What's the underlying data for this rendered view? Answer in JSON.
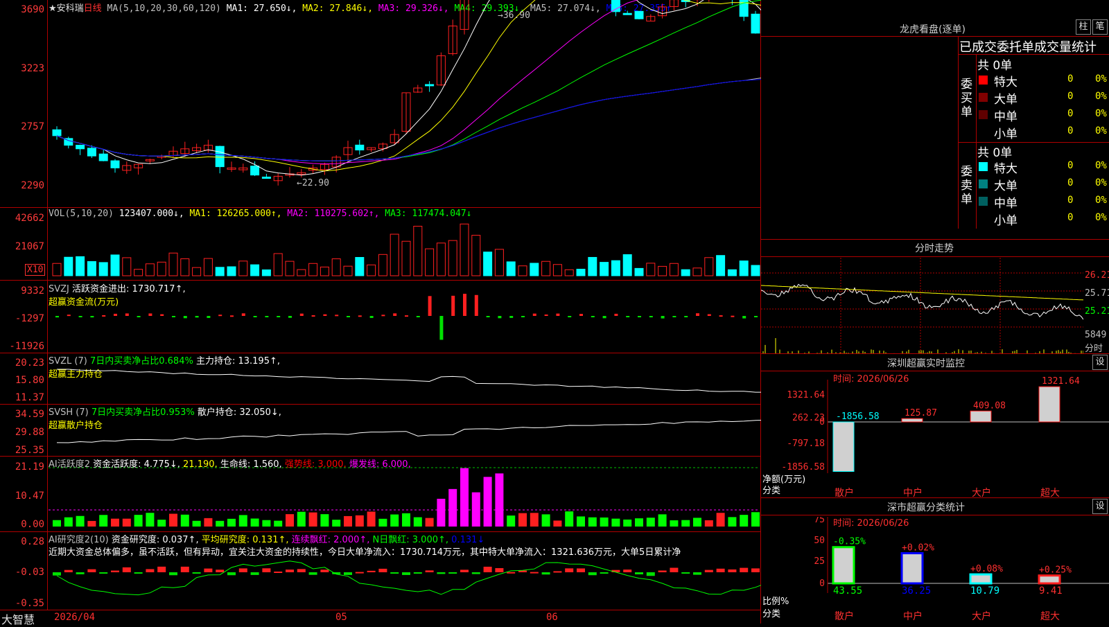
{
  "colors": {
    "up": "#ff2020",
    "down": "#00ffff",
    "ma1": "#ffffff",
    "ma2": "#ffff00",
    "ma3": "#ff00ff",
    "ma4": "#00ff00",
    "ma5": "#c0c0c0",
    "ma6": "#0000ff",
    "grid": "#b00000"
  },
  "header": {
    "stock": "★安科瑞",
    "period": "日线",
    "ma_def": "MA(5,10,20,30,60,120)",
    "ma1": "MA1: 27.650↓,",
    "ma2": "MA2: 27.846↓,",
    "ma3": "MA3: 29.326↓,",
    "ma4": "MA4: 29.393↓,",
    "ma5": "MA5: 27.074↓,",
    "ma6": "MA6: 27.355↑"
  },
  "price_axis": [
    "3690",
    "3223",
    "2757",
    "2290"
  ],
  "price_marks": {
    "high": "36.90",
    "low": "22.90"
  },
  "vol": {
    "title": "VOL(5,10,20)",
    "value": "123407.000↓,",
    "ma1": "MA1: 126265.000↑,",
    "ma2": "MA2: 110275.602↑,",
    "ma3": "MA3: 117474.047↓",
    "axis": [
      "42662",
      "21067"
    ],
    "unit": "X10"
  },
  "svzj": {
    "title": "SVZJ",
    "line1": "活跃资金进出: 1730.717↑,",
    "line2": "超赢资金流(万元)",
    "axis": [
      "9332",
      "-1297",
      "-11926"
    ]
  },
  "svzl": {
    "title": "SVZL (7)",
    "desc": "7日内买卖净占比0.684%",
    "hold": "主力持仓: 13.195↑,",
    "line2": "超赢主力持仓",
    "axis": [
      "20.23",
      "15.80",
      "11.37"
    ]
  },
  "svsh": {
    "title": "SVSH (7)",
    "desc": "7日内买卖净占比0.953%",
    "hold": "散户持仓: 32.050↓,",
    "line2": "超赢散户持仓",
    "axis": [
      "34.59",
      "29.88",
      "25.35"
    ]
  },
  "ai1": {
    "title": "AI活跃度2",
    "a": "资金活跃度: 4.775↓,",
    "b": "21.190,",
    "c": "生命线: 1.560,",
    "d": "强势线: 3.000,",
    "e": "爆发线: 6.000,",
    "axis": [
      "21.19",
      "10.47",
      "0.00"
    ]
  },
  "ai2": {
    "title": "AI研究度2(10)",
    "a": "资金研究度: 0.037↑,",
    "b": "平均研究度: 0.131↑,",
    "c": "连续飘红: 2.000↑,",
    "d": "N日飘红: 3.000↑,",
    "e": "0.131↓",
    "comment": "近期大资金总体偏多，虽不活跃，但有异动，宜关注大资金的持续性，今日大单净流入：1730.714万元，其中特大单净流入：1321.636万元，大单5日累计净",
    "axis": [
      "0.28",
      "-0.03",
      "-0.35"
    ]
  },
  "xaxis": {
    "d1": "2026/04",
    "d2": "05",
    "d3": "06"
  },
  "brand": "大智慧",
  "lh": {
    "title": "龙虎看盘(逐单)",
    "btn1": "柱",
    "btn2": "笔",
    "header": "已成交委托单成交量统计",
    "buy_label": "委买单",
    "sell_label": "委卖单",
    "buy_total": "共 0单",
    "sell_total": "共 0单",
    "buy": [
      {
        "name": "特大",
        "v": "0",
        "p": "0%",
        "c": "#ff0000"
      },
      {
        "name": "大单",
        "v": "0",
        "p": "0%",
        "c": "#800000"
      },
      {
        "name": "中单",
        "v": "0",
        "p": "0%",
        "c": "#600000"
      },
      {
        "name": "小单",
        "v": "0",
        "p": "0%",
        "c": "#000000"
      }
    ],
    "sell": [
      {
        "name": "特大",
        "v": "0",
        "p": "0%",
        "c": "#00ffff"
      },
      {
        "name": "大单",
        "v": "0",
        "p": "0%",
        "c": "#008080"
      },
      {
        "name": "中单",
        "v": "0",
        "p": "0%",
        "c": "#006060"
      },
      {
        "name": "小单",
        "v": "0",
        "p": "0%",
        "c": "#000000"
      }
    ]
  },
  "fs": {
    "title": "分时走势",
    "axis": [
      "26.21",
      "25.71",
      "25.21"
    ],
    "vol": "5849",
    "vol_unit": "分时"
  },
  "szrt": {
    "title": "深圳超赢实时监控",
    "btn": "设",
    "time": "时间: 2026/06/26",
    "axis": [
      "1321.64",
      "262.23",
      "0",
      "-797.18",
      "-1856.58"
    ],
    "ylabel1": "净额(万元)",
    "ylabel2": "分类",
    "bars": [
      {
        "cat": "散户",
        "label": "-1856.58",
        "v": -1856.58
      },
      {
        "cat": "中户",
        "label": "125.87",
        "v": 125.87
      },
      {
        "cat": "大户",
        "label": "409.08",
        "v": 409.08
      },
      {
        "cat": "超大",
        "label": "1321.64",
        "v": 1321.64
      }
    ]
  },
  "szfl": {
    "title": "深市超赢分类统计",
    "btn": "设",
    "time": "时间: 2026/06/26",
    "axis": [
      "75",
      "50",
      "25",
      "0"
    ],
    "ylabel1": "比例%",
    "ylabel2": "分类",
    "bars": [
      {
        "cat": "散户",
        "top": "-0.35%",
        "bottom": "43.55",
        "v": 43.55
      },
      {
        "cat": "中户",
        "top": "+0.02%",
        "bottom": "36.25",
        "v": 36.25
      },
      {
        "cat": "大户",
        "top": "+0.08%",
        "bottom": "10.79",
        "v": 10.79
      },
      {
        "cat": "超大",
        "top": "+0.25%",
        "bottom": "9.41",
        "v": 9.41
      }
    ]
  }
}
